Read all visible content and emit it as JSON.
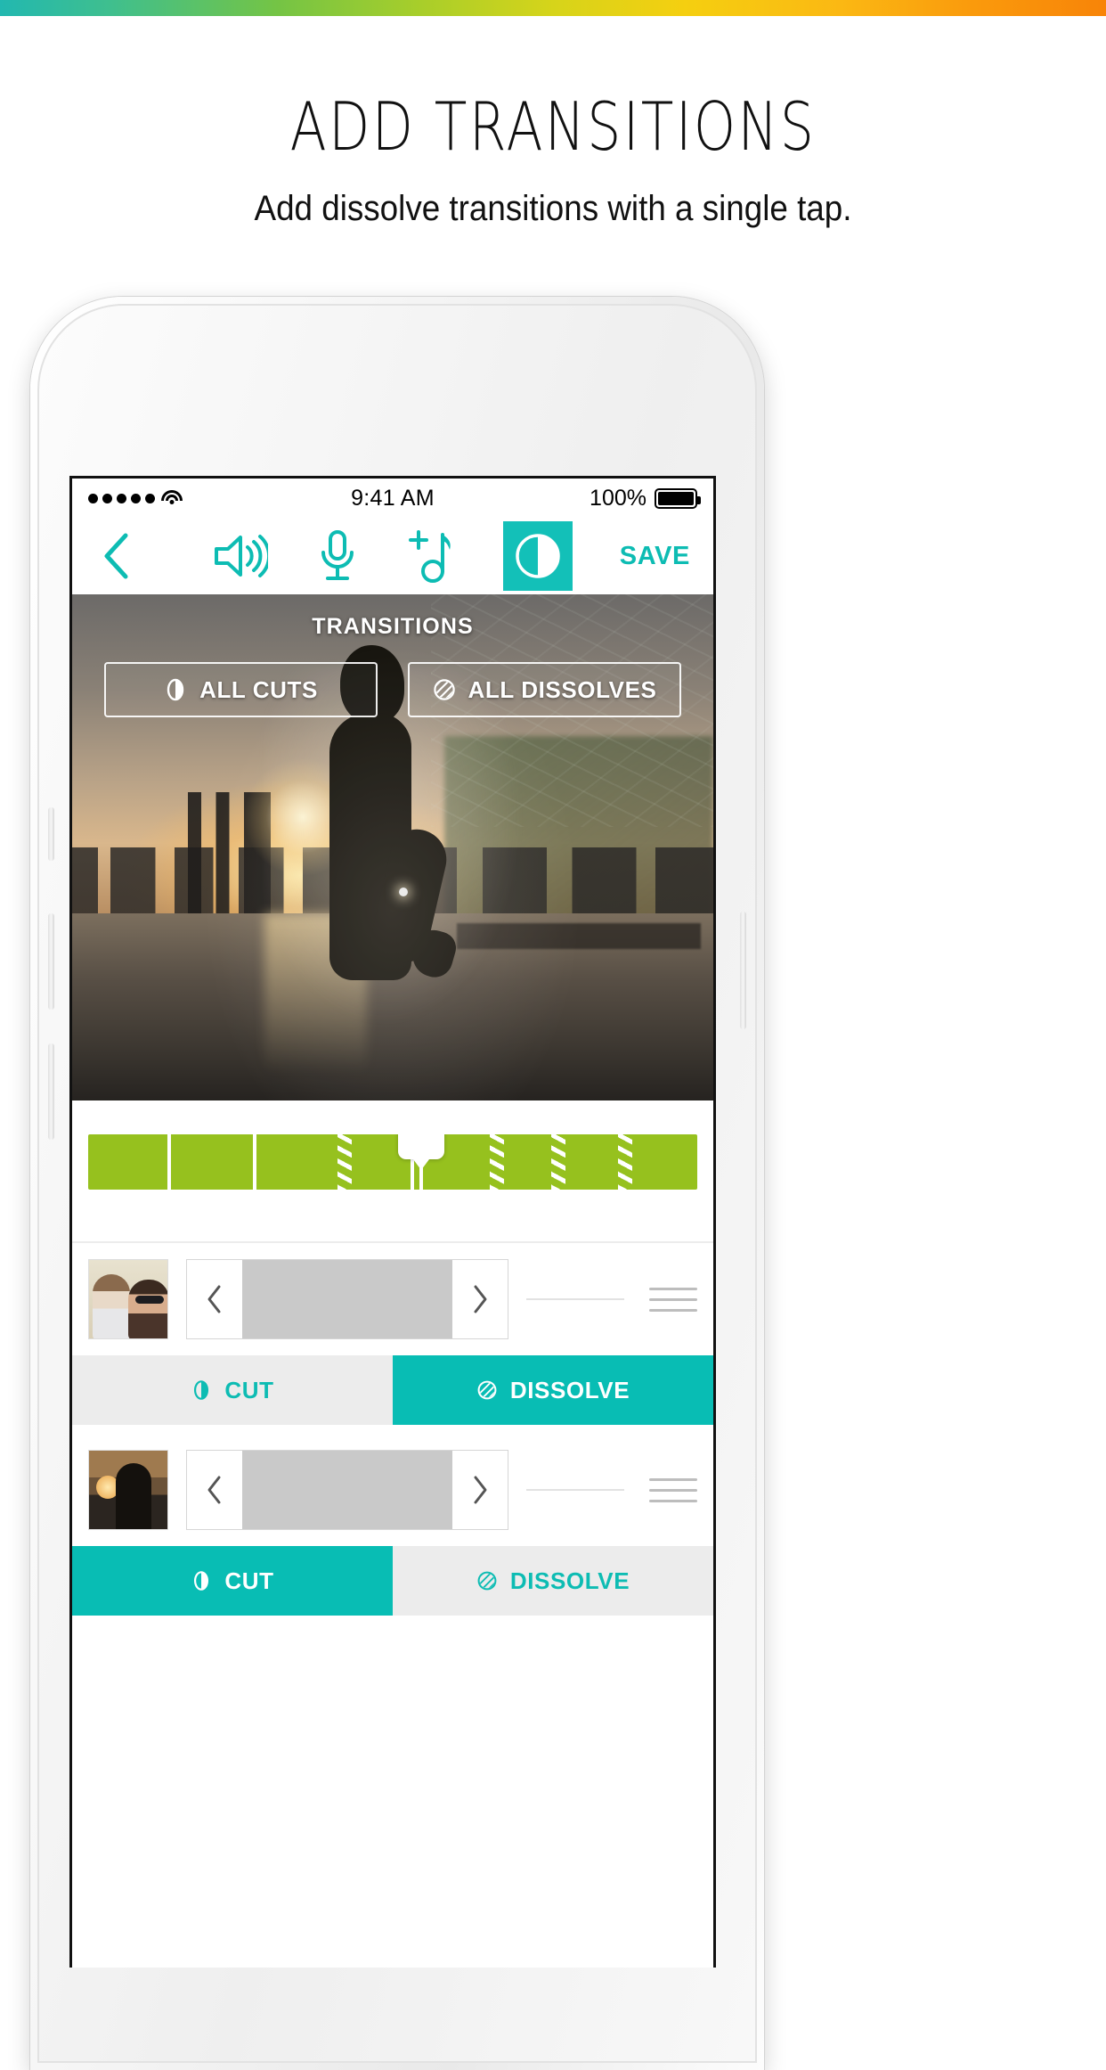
{
  "promo": {
    "title": "ADD TRANSITIONS",
    "subtitle": "Add dissolve transitions with a single tap.",
    "gradient_start": "#22b8b0",
    "gradient_mid": "#d6d41a",
    "gradient_end": "#f88408"
  },
  "status_bar": {
    "signal_icon": "signal-dots-icon",
    "wifi_icon": "wifi-icon",
    "time": "9:41 AM",
    "battery_percent": "100%",
    "battery_icon": "battery-full-icon"
  },
  "toolbar": {
    "back_icon": "chevron-left-icon",
    "volume_icon": "speaker-volume-icon",
    "voiceover_icon": "microphone-icon",
    "music_icon": "add-music-note-icon",
    "transitions_icon": "transition-circle-icon",
    "save_label": "SAVE",
    "accent_color": "#0dbcb3",
    "active_tool": "transitions"
  },
  "preview": {
    "overlay_title": "TRANSITIONS",
    "buttons": [
      {
        "label": "ALL CUTS",
        "icon": "cut-circle-icon"
      },
      {
        "label": "ALL DISSOLVES",
        "icon": "dissolve-circle-icon"
      }
    ]
  },
  "timeline": {
    "track_color": "#96c11e",
    "playhead_icon": "playhead-handle-icon",
    "segments": [
      {
        "width_pct": 13,
        "boundary": "start"
      },
      {
        "width_pct": 14,
        "boundary": "cut"
      },
      {
        "width_pct": 14,
        "boundary": "cut"
      },
      {
        "width_pct": 12,
        "boundary": "dissolve"
      },
      {
        "width_pct": 13,
        "boundary": "cut"
      },
      {
        "width_pct": 10,
        "boundary": "dissolve"
      },
      {
        "width_pct": 11,
        "boundary": "dissolve"
      },
      {
        "width_pct": 13,
        "boundary": "dissolve"
      }
    ]
  },
  "clips": [
    {
      "thumbnail_name": "clip-thumbnail-couple",
      "prev_icon": "chevron-left-icon",
      "next_icon": "chevron-right-icon",
      "drag_icon": "reorder-handle-icon",
      "transition": {
        "cut_label": "CUT",
        "cut_icon": "cut-circle-icon",
        "dissolve_label": "DISSOLVE",
        "dissolve_icon": "dissolve-circle-icon",
        "selected": "dissolve"
      }
    },
    {
      "thumbnail_name": "clip-thumbnail-silhouette",
      "prev_icon": "chevron-left-icon",
      "next_icon": "chevron-right-icon",
      "drag_icon": "reorder-handle-icon",
      "transition": {
        "cut_label": "CUT",
        "cut_icon": "cut-circle-icon",
        "dissolve_label": "DISSOLVE",
        "dissolve_icon": "dissolve-circle-icon",
        "selected": "cut"
      }
    }
  ]
}
